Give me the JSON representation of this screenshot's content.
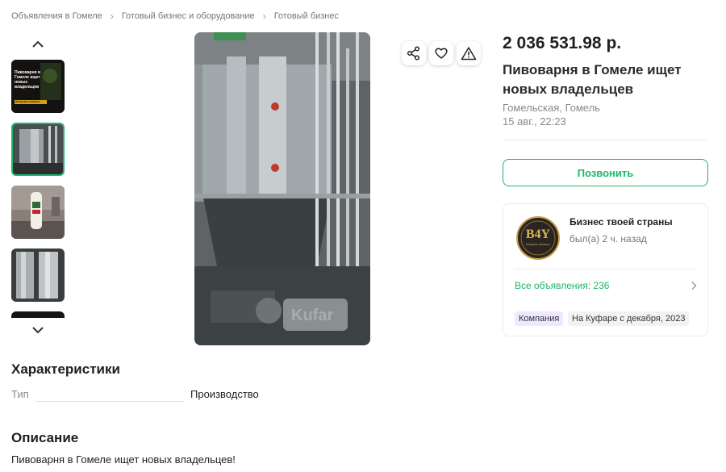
{
  "breadcrumb": [
    "Объявления в Гомеле",
    "Готовый бизнес и оборудование",
    "Готовый бизнес"
  ],
  "gallery": {
    "thumbnail_caption": "Пивоварня в Гомеле ищет новых владельцев",
    "thumbnail_badge": "ПРОДАЖА БИЗНЕСА",
    "watermark": "Kufar"
  },
  "listing": {
    "price": "2 036 531.98 р.",
    "title": "Пивоварня в Гомеле ищет новых владельцев",
    "location": "Гомельская, Гомель",
    "date": "15 авг., 22:23",
    "call_label": "Позвонить"
  },
  "seller": {
    "logo_text": "B4Y",
    "logo_subtext": "ПРОДАЖА БИЗНЕСА",
    "name": "Бизнес твоей страны",
    "status": "был(а) 2 ч. назад",
    "all_ads": "Все объявления: 236",
    "badge_type": "Компания",
    "badge_since": "На Куфаре с декабря, 2023"
  },
  "specs": {
    "title": "Характеристики",
    "rows": [
      {
        "label": "Тип",
        "value": "Производство"
      }
    ]
  },
  "description": {
    "title": "Описание",
    "text": "Пивоварня в Гомеле ищет новых владельцев!"
  },
  "colors": {
    "accent": "#1db56b",
    "company_badge": "#efe6ff",
    "text_muted": "#8a8a8a"
  }
}
